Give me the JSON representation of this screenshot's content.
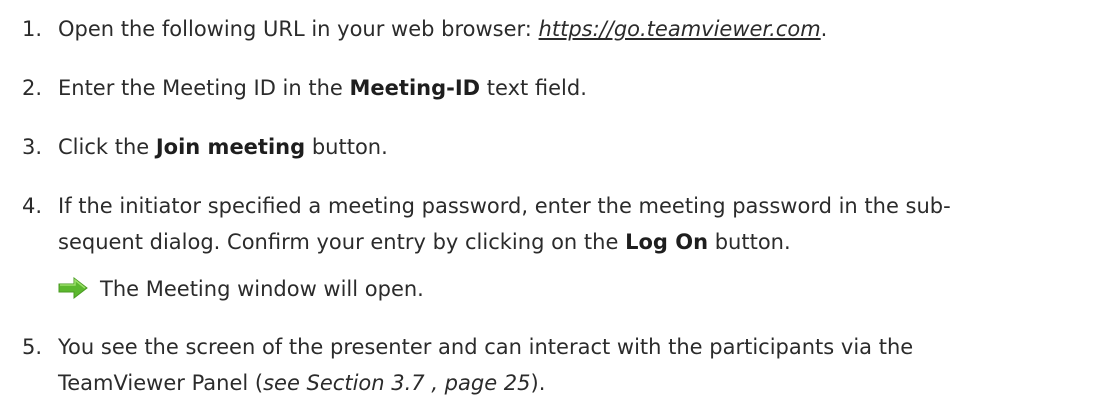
{
  "steps": [
    {
      "number": "1.",
      "text_before": "Open the following URL in your web browser: ",
      "url": "https://go.teamviewer.com",
      "text_after": "."
    },
    {
      "number": "2.",
      "text_before": "Enter the Meeting ID in the ",
      "bold": "Meeting-ID",
      "text_after": " text field."
    },
    {
      "number": "3.",
      "text_before": "Click the ",
      "bold": "Join meeting",
      "text_after": " button."
    },
    {
      "number": "4.",
      "line1": "If the initiator specified a meeting password, enter the meeting password in the sub-",
      "line2_before": "sequent dialog. Confirm your entry by clicking on the ",
      "bold": "Log On",
      "line2_after": " button.",
      "result": "The Meeting window will open."
    },
    {
      "number": "5.",
      "line1": "You see the screen of the presenter and can interact with the participants via the",
      "line2_before": "TeamViewer Panel (",
      "xref": "see Section 3.7 , page 25",
      "line2_after": ")."
    }
  ],
  "colors": {
    "text": "#2b2b2b",
    "arrow": "#5cb82e"
  },
  "icons": {
    "result_arrow": "green-right-arrow-icon"
  }
}
